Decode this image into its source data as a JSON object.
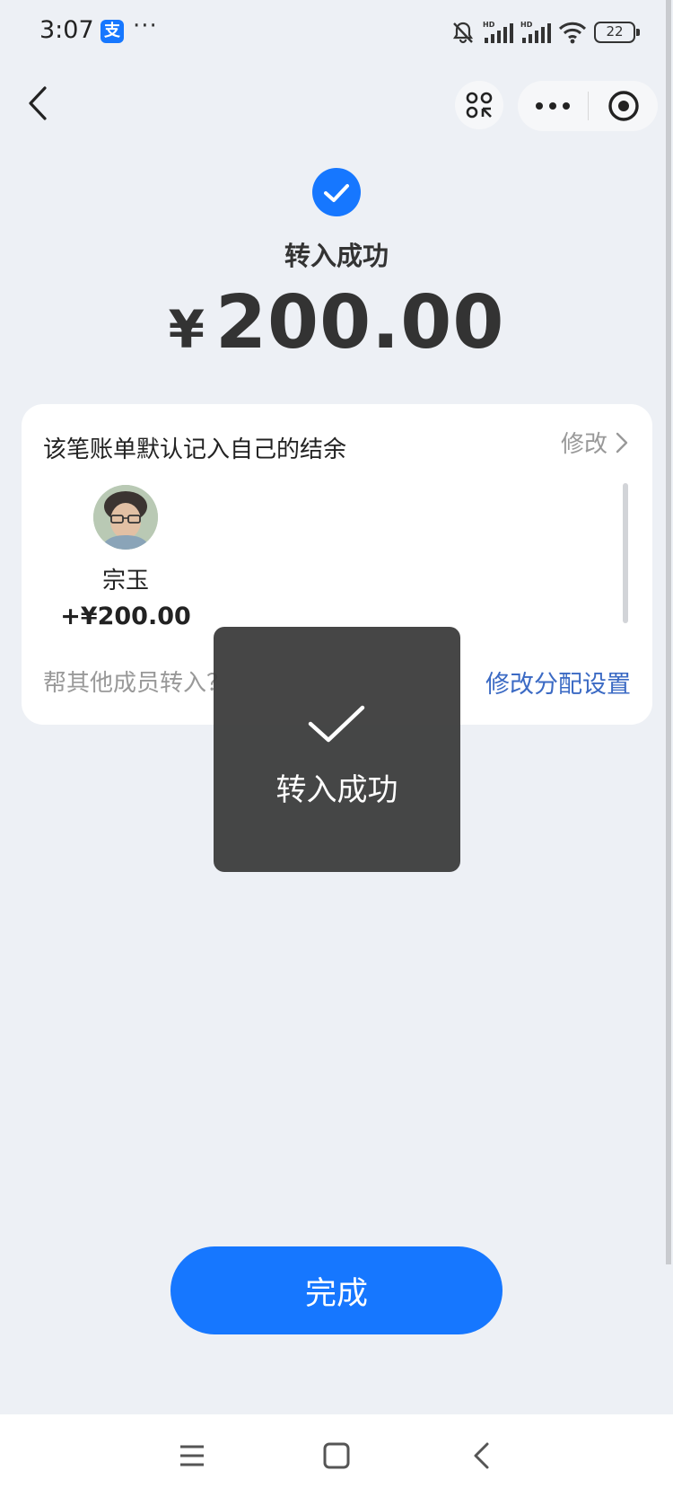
{
  "status_bar": {
    "time": "3:07",
    "app_badge": "支",
    "more": "···",
    "battery": "22"
  },
  "nav": {
    "back_icon": "chevron-left-icon",
    "apps_icon": "mini-program-icon",
    "more_icon": "more-dots-icon",
    "close_icon": "target-close-icon"
  },
  "success": {
    "title": "转入成功",
    "currency": "¥",
    "amount": "200.00",
    "icon_color": "#1677ff"
  },
  "card": {
    "title": "该笔账单默认记入自己的结余",
    "edit_label": "修改",
    "members": [
      {
        "name": "宗玉",
        "amount": "+¥200.00"
      }
    ],
    "help_text": "帮其他成员转入？",
    "settings_link": "修改分配设置"
  },
  "toast": {
    "text": "转入成功"
  },
  "footer": {
    "done_label": "完成",
    "accent": "#1677ff"
  },
  "system_nav": {
    "menu_icon": "menu-icon",
    "home_icon": "home-square-icon",
    "back_icon": "back-chevron-icon"
  }
}
